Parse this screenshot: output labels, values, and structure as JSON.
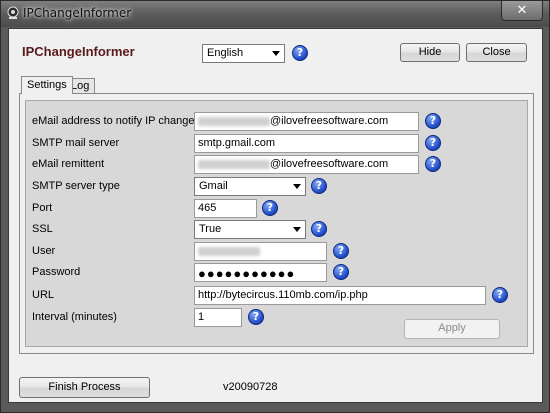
{
  "window": {
    "title": "IPChangeInformer",
    "close_glyph": "✕"
  },
  "header": {
    "app_name": "IPChangeInformer",
    "language": "English",
    "hide_label": "Hide",
    "close_label": "Close"
  },
  "tabs": [
    "Settings",
    "Log"
  ],
  "form": {
    "email_label": "eMail address to notify IP change",
    "email_domain": "@ilovefreesoftware.com",
    "smtp_label": "SMTP mail server",
    "smtp_value": "smtp.gmail.com",
    "remittent_label": "eMail remittent",
    "remittent_domain": "@ilovefreesoftware.com",
    "server_type_label": "SMTP server type",
    "server_type_value": "Gmail",
    "port_label": "Port",
    "port_value": "465",
    "ssl_label": "SSL",
    "ssl_value": "True",
    "user_label": "User",
    "password_label": "Password",
    "password_value": "●●●●●●●●●●●",
    "url_label": "URL",
    "url_value": "http://bytecircus.110mb.com/ip.php",
    "interval_label": "Interval (minutes)",
    "interval_value": "1",
    "apply_label": "Apply"
  },
  "footer": {
    "finish_label": "Finish Process",
    "version": "v20090728"
  },
  "help_glyph": "?",
  "colors": {
    "heading": "#5a1a1a",
    "help_icon": "#1d48c8"
  }
}
